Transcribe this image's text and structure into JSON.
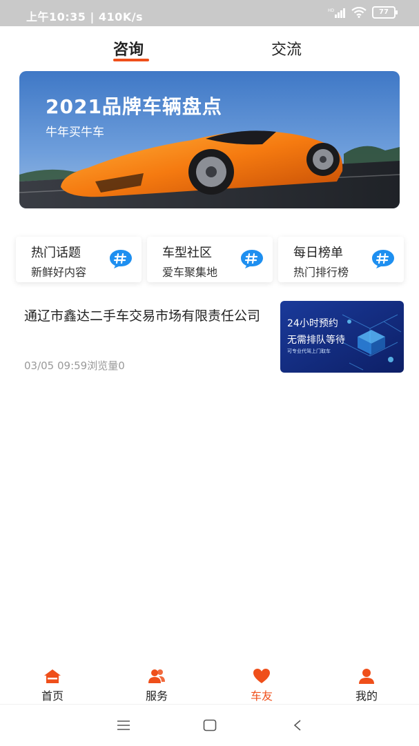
{
  "status_bar": {
    "time": "上午10:35 | 410K/s",
    "battery": "77"
  },
  "tabs": [
    {
      "label": "咨询",
      "active": true
    },
    {
      "label": "交流",
      "active": false
    }
  ],
  "banner": {
    "title": "2021品牌车辆盘点",
    "subtitle": "牛年买牛车"
  },
  "categories": [
    {
      "title": "热门话题",
      "subtitle": "新鲜好内容",
      "icon": "hashtag-bubble-icon"
    },
    {
      "title": "车型社区",
      "subtitle": "爱车聚集地",
      "icon": "hashtag-bubble-icon"
    },
    {
      "title": "每日榜单",
      "subtitle": "热门排行榜",
      "icon": "hashtag-bubble-icon"
    }
  ],
  "article": {
    "title": "通辽市鑫达二手车交易市场有限责任公司",
    "meta": "03/05 09:59浏览量0",
    "thumb_line1": "24小时预约",
    "thumb_line2": "无需排队等待",
    "thumb_line3": "可专业代驾上门取车"
  },
  "bottom_nav": [
    {
      "label": "首页",
      "icon": "home-icon",
      "active": false
    },
    {
      "label": "服务",
      "icon": "users-icon",
      "active": false
    },
    {
      "label": "车友",
      "icon": "heart-icon",
      "active": true
    },
    {
      "label": "我的",
      "icon": "user-icon",
      "active": false
    }
  ],
  "colors": {
    "accent": "#ef4f1a",
    "icon_blue": "#1e8ff0"
  }
}
